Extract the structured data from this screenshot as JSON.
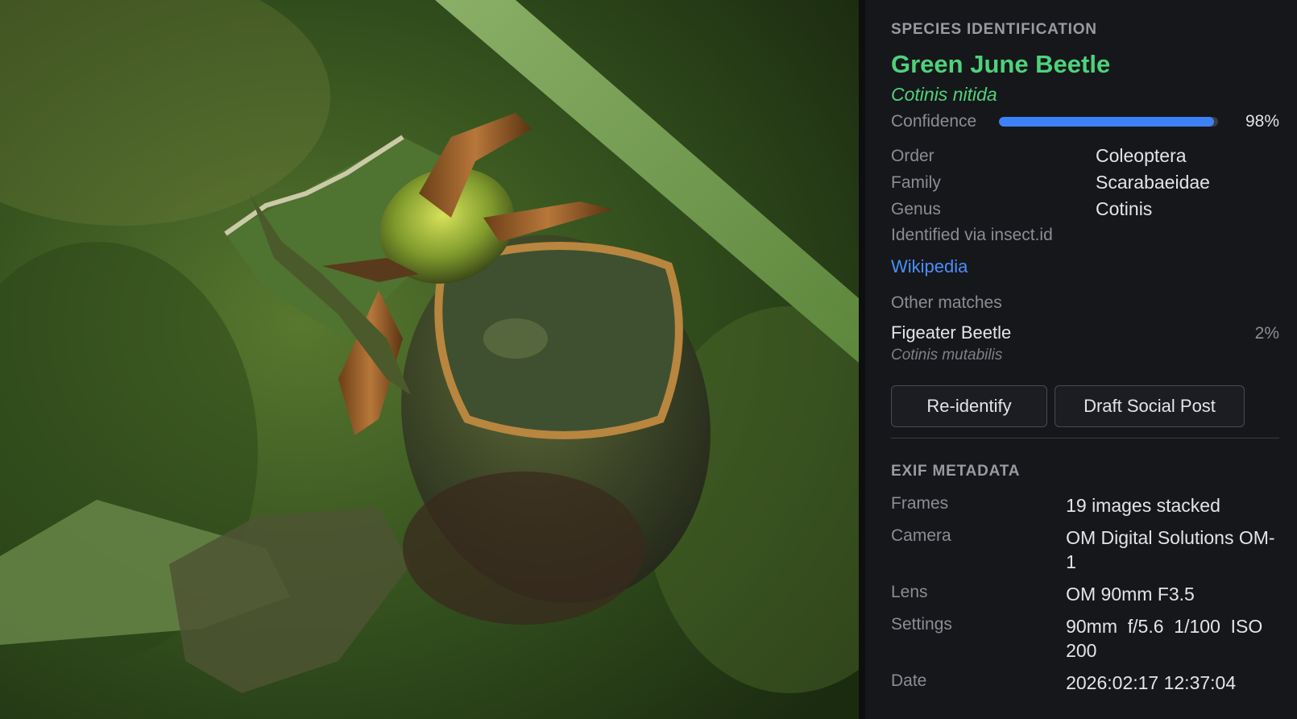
{
  "photo": {
    "alt_icon": "beetle-photo"
  },
  "species": {
    "section_title": "SPECIES IDENTIFICATION",
    "common_name": "Green June Beetle",
    "scientific_name": "Cotinis nitida",
    "confidence_label": "Confidence",
    "confidence_value": "98%",
    "confidence_fraction": 0.98,
    "taxonomy": [
      {
        "key": "Order",
        "value": "Coleoptera"
      },
      {
        "key": "Family",
        "value": "Scarabaeidae"
      },
      {
        "key": "Genus",
        "value": "Cotinis"
      }
    ],
    "identified_via": "Identified via insect.id",
    "wikipedia_link": "Wikipedia",
    "other_matches_title": "Other matches",
    "other_matches": [
      {
        "name": "Figeater Beetle",
        "scientific": "Cotinis mutabilis",
        "pct": "2%"
      }
    ],
    "buttons": {
      "reidentify": "Re-identify",
      "draft_post": "Draft Social Post"
    }
  },
  "exif": {
    "section_title": "EXIF METADATA",
    "rows": [
      {
        "key": "Frames",
        "value": "19 images stacked"
      },
      {
        "key": "Camera",
        "value": "OM Digital Solutions OM-1"
      },
      {
        "key": "Lens",
        "value": "OM 90mm F3.5"
      },
      {
        "key": "Settings",
        "value": "90mm  f/5.6  1/100  ISO 200"
      },
      {
        "key": "Date",
        "value": "2026:02:17 12:37:04"
      }
    ]
  },
  "colors": {
    "accent_green": "#4ed27a",
    "link_blue": "#4b8ef8",
    "bar_blue": "#3c82f6",
    "panel_bg": "#16171b"
  }
}
